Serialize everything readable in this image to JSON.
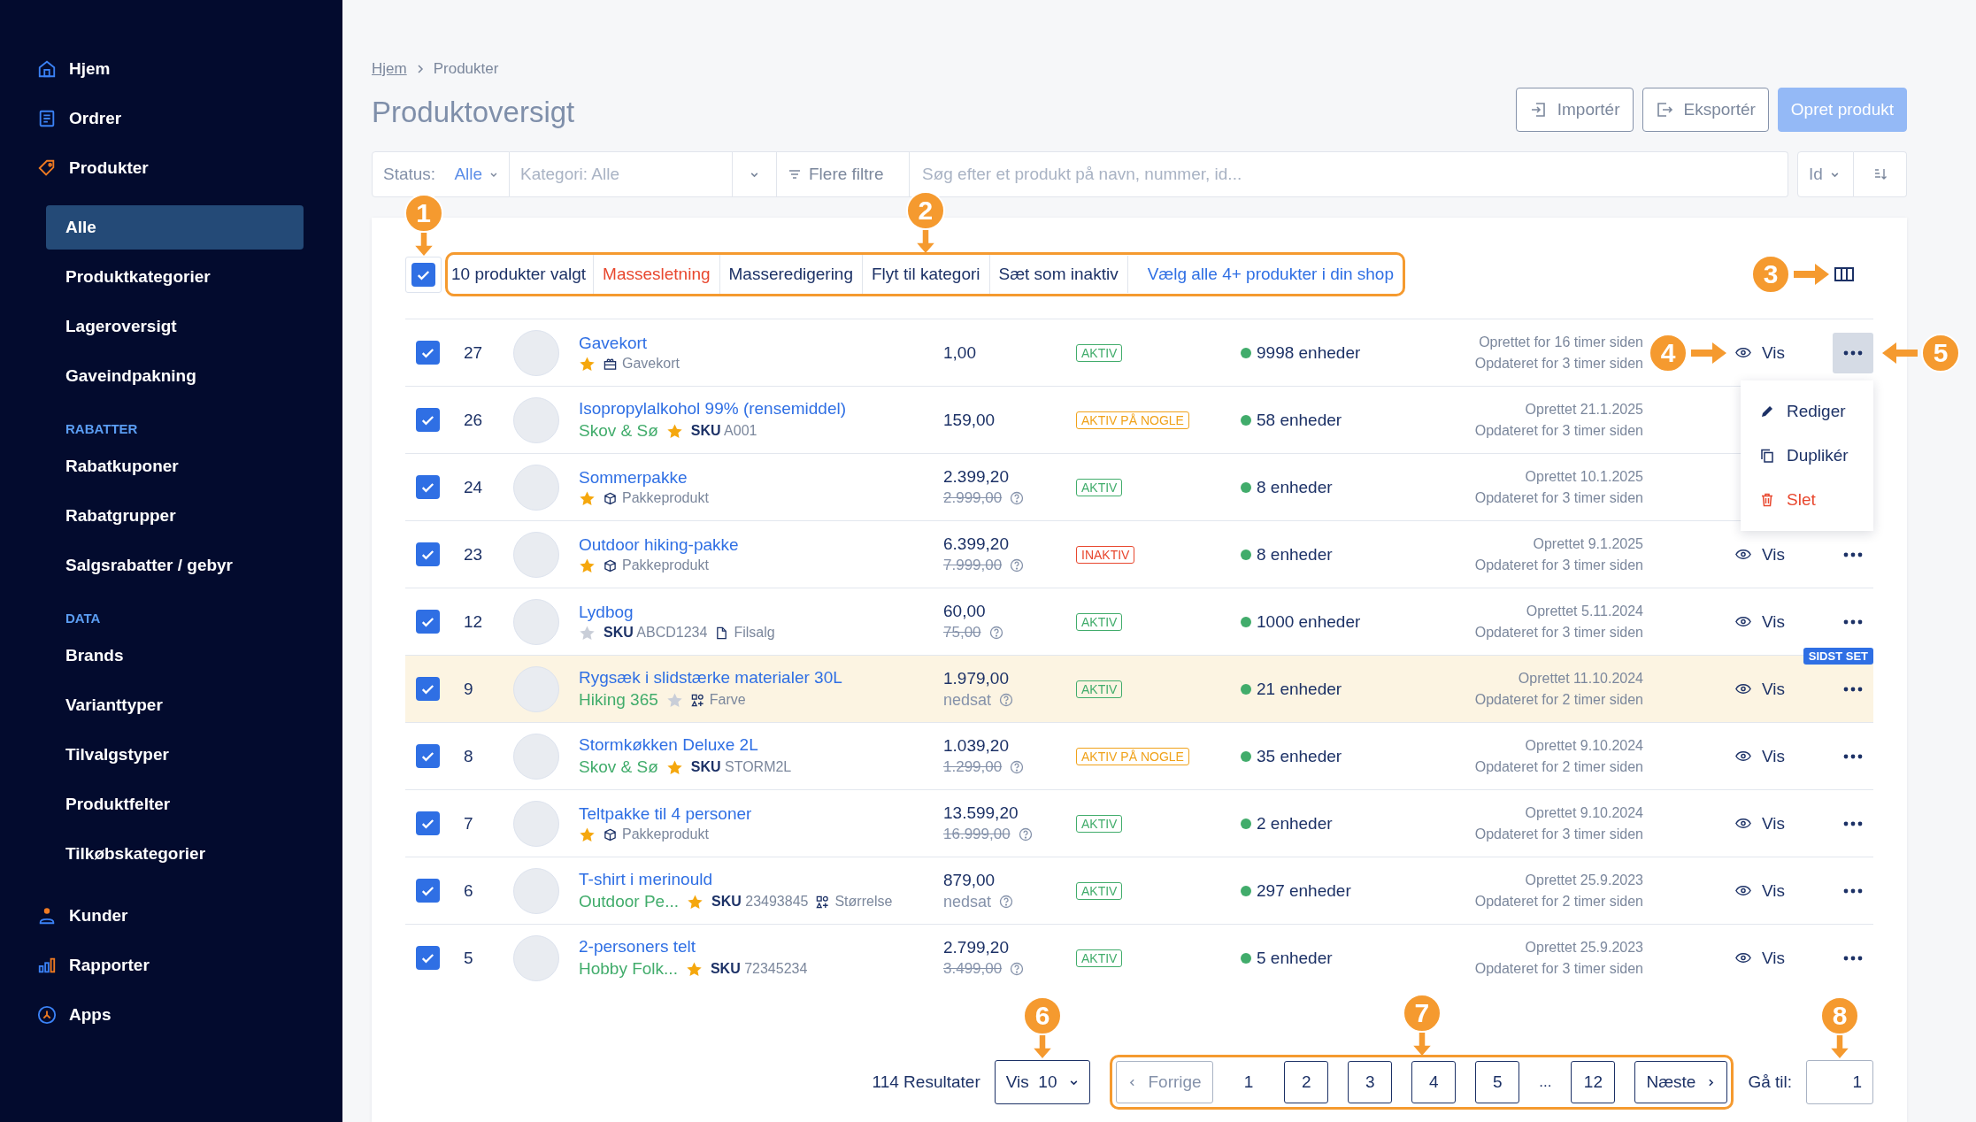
{
  "sidebar": {
    "top": [
      {
        "label": "Hjem"
      },
      {
        "label": "Ordrer"
      }
    ],
    "section": {
      "label": "Produkter",
      "items": [
        {
          "label": "Alle",
          "selected": true
        },
        {
          "label": "Produktkategorier",
          "selected": false
        },
        {
          "label": "Lageroversigt",
          "selected": false
        },
        {
          "label": "Gaveindpakning",
          "selected": false
        }
      ],
      "groups": [
        {
          "heading": "RABATTER",
          "items": [
            {
              "label": "Rabatkuponer",
              "selected": false
            },
            {
              "label": "Rabatgrupper",
              "selected": false
            },
            {
              "label": "Salgsrabatter / gebyr",
              "selected": false
            }
          ]
        },
        {
          "heading": "DATA",
          "items": [
            {
              "label": "Brands",
              "selected": false
            },
            {
              "label": "Varianttyper",
              "selected": false
            },
            {
              "label": "Tilvalgstyper",
              "selected": false
            },
            {
              "label": "Produktfelter",
              "selected": false
            },
            {
              "label": "Tilkøbskategorier",
              "selected": false
            }
          ]
        }
      ]
    },
    "bottom": [
      {
        "label": "Kunder"
      },
      {
        "label": "Rapporter"
      },
      {
        "label": "Apps"
      }
    ]
  },
  "breadcrumb": {
    "link": "Hjem",
    "current": "Produkter"
  },
  "title": "Produktoversigt",
  "header_buttons": [
    {
      "label": "Importér",
      "kind": "import"
    },
    {
      "label": "Eksportér",
      "kind": "export"
    },
    {
      "label": "Opret produkt",
      "kind": "primary"
    }
  ],
  "filters": {
    "status": {
      "label": "Status:",
      "value": "Alle"
    },
    "category": {
      "placeholder": "Kategori: Alle"
    },
    "more_filters": "Flere filtre",
    "search": {
      "placeholder": "Søg efter et produkt på navn, nummer, id..."
    },
    "sort": {
      "value": "Id"
    }
  },
  "bulk_bar": {
    "checked": true,
    "callout": "1",
    "outlined": true,
    "summary": "10 produkter valgt",
    "actions": [
      {
        "label": "Massesletning",
        "kind": "danger"
      },
      {
        "label": "Masseredigering",
        "kind": "normal"
      },
      {
        "label": "Flyt til kategori",
        "kind": "normal",
        "callout": "2"
      },
      {
        "label": "Sæt som inaktiv",
        "kind": "normal"
      }
    ],
    "select_all": "Vælg alle 4+ produkter i din shop",
    "columns_callout": "3"
  },
  "rows": [
    {
      "checked": true,
      "id": "27",
      "name": "Gavekort",
      "starred": true,
      "meta": {
        "kind": "gift",
        "label": "Gavekort"
      },
      "price": {
        "current": "1,00"
      },
      "status": {
        "label": "AKTIV",
        "kind": "active"
      },
      "stock": "9998 enheder",
      "created": "Oprettet for 16 timer siden",
      "updated": "Opdateret for 3 timer siden",
      "view": "Vis",
      "menu_open": true,
      "highlighted": false,
      "view_callout": "4",
      "menu_callout": "5",
      "menu": [
        {
          "label": "Rediger",
          "kind": "edit"
        },
        {
          "label": "Duplikér",
          "kind": "duplicate"
        },
        {
          "label": "Slet",
          "kind": "delete"
        }
      ]
    },
    {
      "checked": true,
      "id": "26",
      "name": "Isopropylalkohol 99% (rensemiddel)",
      "brand": "Skov & Sø",
      "starred": true,
      "sku": {
        "label": "SKU",
        "value": "A001"
      },
      "price": {
        "current": "159,00"
      },
      "status": {
        "label": "AKTIV PÅ NOGLE",
        "kind": "partial"
      },
      "stock": "58 enheder",
      "created": "Oprettet 21.1.2025",
      "updated": "Opdateret for 3 timer siden",
      "highlighted": false
    },
    {
      "checked": true,
      "id": "24",
      "name": "Sommerpakke",
      "starred": true,
      "meta": {
        "kind": "package",
        "label": "Pakkeprodukt"
      },
      "price": {
        "current": "2.399,20",
        "original": "2.999,00"
      },
      "status": {
        "label": "AKTIV",
        "kind": "active"
      },
      "stock": "8 enheder",
      "created": "Oprettet 10.1.2025",
      "updated": "Opdateret for 3 timer siden",
      "highlighted": false
    },
    {
      "checked": true,
      "id": "23",
      "name": "Outdoor hiking-pakke",
      "starred": true,
      "meta": {
        "kind": "package",
        "label": "Pakkeprodukt"
      },
      "price": {
        "current": "6.399,20",
        "original": "7.999,00"
      },
      "status": {
        "label": "INAKTIV",
        "kind": "inactive"
      },
      "stock": "8 enheder",
      "created": "Oprettet 9.1.2025",
      "updated": "Opdateret for 3 timer siden",
      "view": "Vis",
      "menu_open": false,
      "highlighted": false
    },
    {
      "checked": true,
      "id": "12",
      "name": "Lydbog",
      "starred": false,
      "sku": {
        "label": "SKU",
        "value": "ABCD1234"
      },
      "meta": {
        "kind": "file",
        "label": "Filsalg"
      },
      "price": {
        "current": "60,00",
        "original": "75,00"
      },
      "status": {
        "label": "AKTIV",
        "kind": "active"
      },
      "stock": "1000 enheder",
      "created": "Oprettet 5.11.2024",
      "updated": "Opdateret for 3 timer siden",
      "view": "Vis",
      "menu_open": false,
      "highlighted": false
    },
    {
      "checked": true,
      "id": "9",
      "name": "Rygsæk i slidstærke materialer 30L",
      "brand": "Hiking 365",
      "starred": false,
      "meta": {
        "kind": "variant",
        "label": "Farve"
      },
      "price": {
        "current": "1.979,00",
        "note": "nedsat"
      },
      "status": {
        "label": "AKTIV",
        "kind": "active"
      },
      "stock": "21 enheder",
      "created": "Oprettet 11.10.2024",
      "updated": "Opdateret for 2 timer siden",
      "view": "Vis",
      "menu_open": false,
      "highlighted": true,
      "badge": "SIDST SET"
    },
    {
      "checked": true,
      "id": "8",
      "name": "Stormkøkken Deluxe 2L",
      "brand": "Skov & Sø",
      "starred": true,
      "sku": {
        "label": "SKU",
        "value": "STORM2L"
      },
      "price": {
        "current": "1.039,20",
        "original": "1.299,00"
      },
      "status": {
        "label": "AKTIV PÅ NOGLE",
        "kind": "partial"
      },
      "stock": "35 enheder",
      "created": "Oprettet 9.10.2024",
      "updated": "Opdateret for 2 timer siden",
      "view": "Vis",
      "menu_open": false,
      "highlighted": false
    },
    {
      "checked": true,
      "id": "7",
      "name": "Teltpakke til 4 personer",
      "starred": true,
      "meta": {
        "kind": "package",
        "label": "Pakkeprodukt"
      },
      "price": {
        "current": "13.599,20",
        "original": "16.999,00"
      },
      "status": {
        "label": "AKTIV",
        "kind": "active"
      },
      "stock": "2 enheder",
      "created": "Oprettet 9.10.2024",
      "updated": "Opdateret for 3 timer siden",
      "view": "Vis",
      "menu_open": false,
      "highlighted": false
    },
    {
      "checked": true,
      "id": "6",
      "name": "T-shirt i merinould",
      "brand": "Outdoor Pe...",
      "starred": true,
      "sku": {
        "label": "SKU",
        "value": "23493845"
      },
      "meta": {
        "kind": "variant",
        "label": "Størrelse"
      },
      "price": {
        "current": "879,00",
        "note": "nedsat"
      },
      "status": {
        "label": "AKTIV",
        "kind": "active"
      },
      "stock": "297 enheder",
      "created": "Oprettet 25.9.2023",
      "updated": "Opdateret for 2 timer siden",
      "view": "Vis",
      "menu_open": false,
      "highlighted": false
    },
    {
      "checked": true,
      "id": "5",
      "name": "2-personers telt",
      "brand": "Hobby Folk...",
      "starred": true,
      "sku": {
        "label": "SKU",
        "value": "72345234"
      },
      "price": {
        "current": "2.799,20",
        "original": "3.499,00"
      },
      "status": {
        "label": "AKTIV",
        "kind": "active"
      },
      "stock": "5 enheder",
      "created": "Oprettet 25.9.2023",
      "updated": "Opdateret for 3 timer siden",
      "view": "Vis",
      "menu_open": false,
      "highlighted": false
    }
  ],
  "footer": {
    "results": "114 Resultater",
    "per_page": {
      "label": "Vis",
      "value": "10",
      "callout": "6"
    },
    "pagination": {
      "outlined": true,
      "callout": "7",
      "previous": {
        "label": "Forrige",
        "disabled": true
      },
      "pages": [
        {
          "label": "1",
          "kind": "page",
          "selected": true
        },
        {
          "label": "2",
          "kind": "page",
          "selected": false
        },
        {
          "label": "3",
          "kind": "page",
          "selected": false
        },
        {
          "label": "4",
          "kind": "page",
          "selected": false
        },
        {
          "label": "5",
          "kind": "page",
          "selected": false
        },
        {
          "label": "...",
          "kind": "ellipsis"
        },
        {
          "label": "12",
          "kind": "page",
          "selected": false
        }
      ],
      "next": {
        "label": "Næste"
      }
    },
    "goto": {
      "label": "Gå til:",
      "value": "1",
      "callout": "8"
    }
  }
}
